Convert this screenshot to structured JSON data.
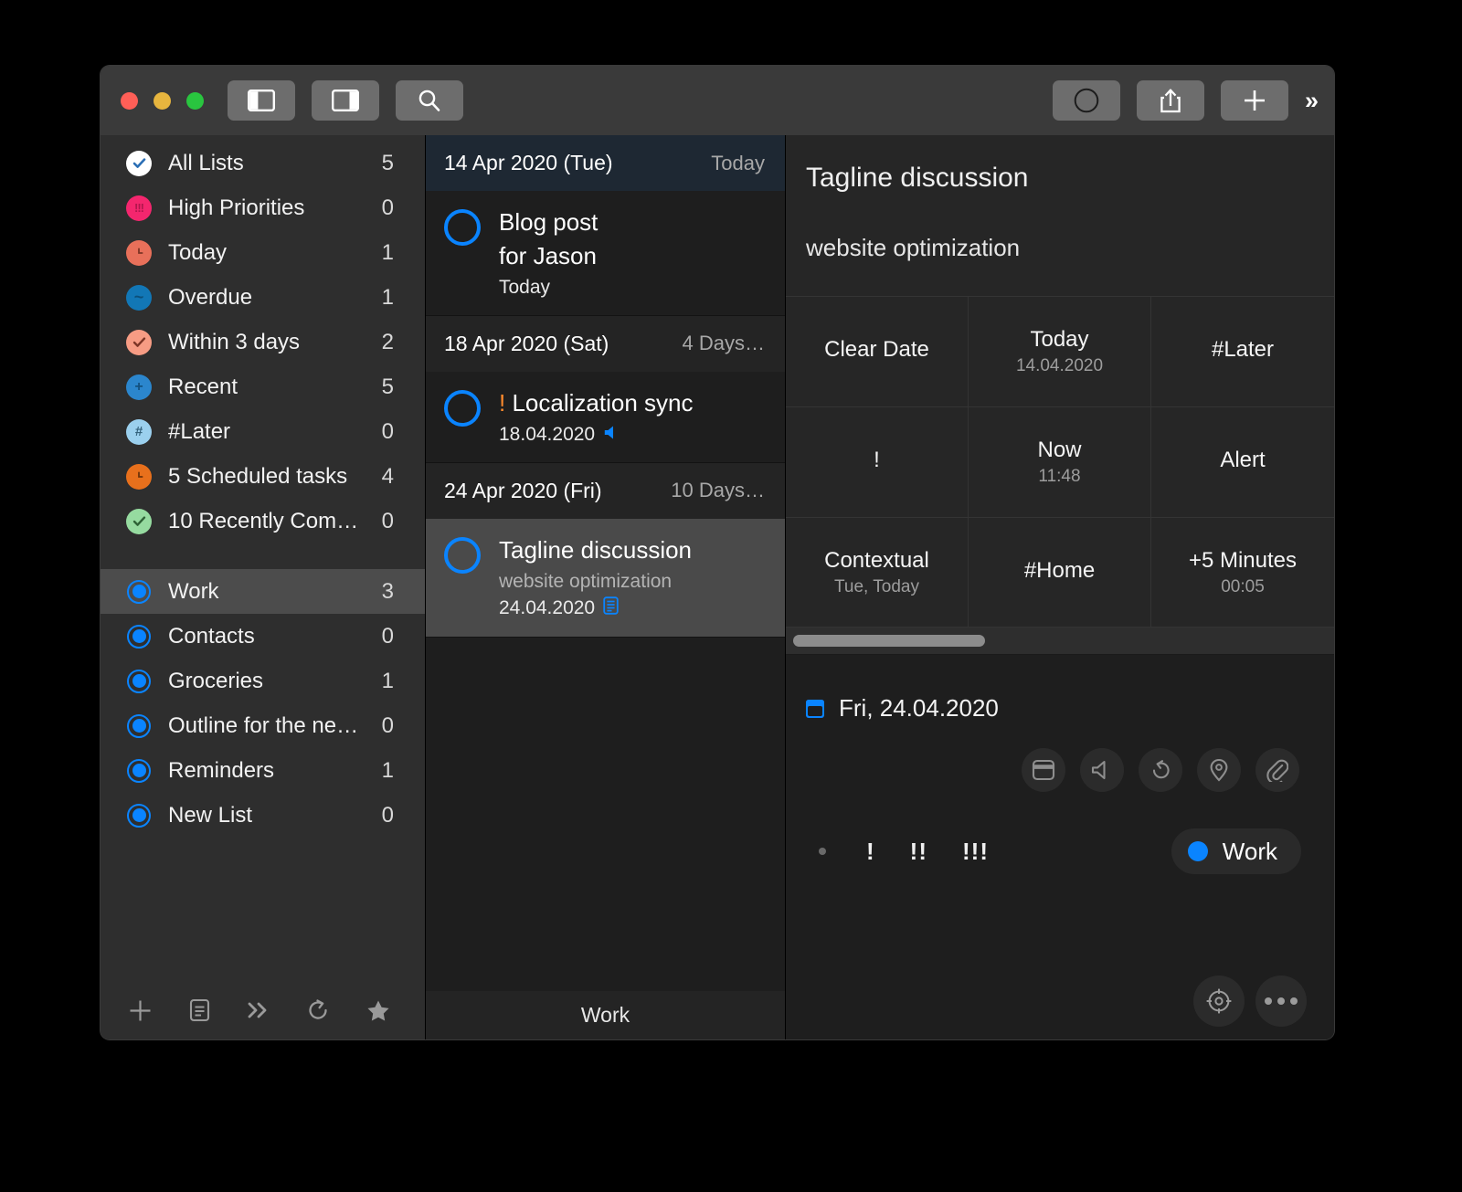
{
  "titlebar": {
    "window_buttons": [
      "close",
      "minimize",
      "maximize"
    ],
    "left_buttons": [
      {
        "name": "toggle-sidebar-button",
        "icon": "sidebar-left-icon"
      },
      {
        "name": "toggle-detail-button",
        "icon": "sidebar-right-icon"
      },
      {
        "name": "search-button",
        "icon": "search-icon"
      }
    ],
    "right_buttons": [
      {
        "name": "complete-button",
        "icon": "circle-icon"
      },
      {
        "name": "share-button",
        "icon": "share-icon"
      },
      {
        "name": "add-task-button",
        "icon": "plus-icon"
      }
    ],
    "overflow_label": "»"
  },
  "sidebar": {
    "smart_lists": [
      {
        "label": "All Lists",
        "count": "5",
        "icon": "check-circle-icon",
        "color": "#ffffff",
        "glyph": "✔"
      },
      {
        "label": "High Priorities",
        "count": "0",
        "icon": "exclamation-circle-icon",
        "color": "#f4266e",
        "glyph": "!!!"
      },
      {
        "label": "Today",
        "count": "1",
        "icon": "clock-circle-icon",
        "color": "#e8705a",
        "glyph": "clock"
      },
      {
        "label": "Overdue",
        "count": "1",
        "icon": "tilde-circle-icon",
        "color": "#1277b6",
        "glyph": "~"
      },
      {
        "label": "Within 3 days",
        "count": "2",
        "icon": "check-circle-icon",
        "color": "#f79c84",
        "glyph": "✔"
      },
      {
        "label": "Recent",
        "count": "5",
        "icon": "plus-circle-icon",
        "color": "#2b86cd",
        "glyph": "+"
      },
      {
        "label": "#Later",
        "count": "0",
        "icon": "hash-circle-icon",
        "color": "#9bd0ee",
        "glyph": "#"
      },
      {
        "label": "5 Scheduled tasks",
        "count": "4",
        "icon": "clock-circle-icon",
        "color": "#e8701c",
        "glyph": "clock"
      },
      {
        "label": "10 Recently Com…",
        "count": "0",
        "icon": "check-circle-icon",
        "color": "#96dba0",
        "glyph": "✔"
      }
    ],
    "user_lists": [
      {
        "label": "Work",
        "count": "3",
        "icon": "list-ring-icon",
        "selected": true
      },
      {
        "label": "Contacts",
        "count": "0",
        "icon": "list-ring-icon",
        "selected": false
      },
      {
        "label": "Groceries",
        "count": "1",
        "icon": "list-ring-icon",
        "selected": false
      },
      {
        "label": "Outline for the ne…",
        "count": "0",
        "icon": "list-ring-icon",
        "selected": false
      },
      {
        "label": "Reminders",
        "count": "1",
        "icon": "list-ring-icon",
        "selected": false
      },
      {
        "label": "New List",
        "count": "0",
        "icon": "list-ring-icon",
        "selected": false
      }
    ],
    "toolbar": [
      {
        "name": "add-list-button",
        "icon": "plus-icon"
      },
      {
        "name": "new-note-button",
        "icon": "note-icon"
      },
      {
        "name": "expand-button",
        "icon": "chevrons-right-icon"
      },
      {
        "name": "refresh-button",
        "icon": "refresh-icon"
      },
      {
        "name": "favorites-button",
        "icon": "star-icon"
      },
      {
        "name": "settings-button",
        "icon": "gear-icon"
      }
    ]
  },
  "task_list": {
    "groups": [
      {
        "date": "14 Apr 2020 (Tue)",
        "relative": "Today",
        "is_today": true,
        "tasks": [
          {
            "title": "Blog post\nfor Jason",
            "note": "",
            "meta": "Today",
            "priority": "",
            "selected": false,
            "has_alert": false,
            "has_note_icon": false
          }
        ]
      },
      {
        "date": "18 Apr 2020 (Sat)",
        "relative": "4 Days…",
        "is_today": false,
        "tasks": [
          {
            "title": "Localization sync",
            "note": "",
            "meta": "18.04.2020",
            "priority": "!",
            "selected": false,
            "has_alert": true,
            "has_note_icon": false
          }
        ]
      },
      {
        "date": "24 Apr 2020 (Fri)",
        "relative": "10 Days…",
        "is_today": false,
        "tasks": [
          {
            "title": "Tagline discussion",
            "note": "website optimization",
            "meta": "24.04.2020",
            "priority": "",
            "selected": true,
            "has_alert": false,
            "has_note_icon": true
          }
        ]
      }
    ],
    "footer_label": "Work"
  },
  "detail": {
    "title": "Tagline discussion",
    "note": "website optimization",
    "quick_actions": [
      {
        "main": "Clear Date",
        "sub": "",
        "name": "clear-date-action"
      },
      {
        "main": "Today",
        "sub": "14.04.2020",
        "name": "today-action"
      },
      {
        "main": "#Later",
        "sub": "",
        "name": "later-tag-action"
      },
      {
        "main": "!",
        "sub": "",
        "name": "priority-action"
      },
      {
        "main": "Now",
        "sub": "11:48",
        "name": "now-action"
      },
      {
        "main": "Alert",
        "sub": "",
        "name": "alert-action"
      },
      {
        "main": "Contextual",
        "sub": "Tue, Today",
        "name": "contextual-action"
      },
      {
        "main": "#Home",
        "sub": "",
        "name": "home-tag-action"
      },
      {
        "main": "+5 Minutes",
        "sub": "00:05",
        "name": "plus-five-minutes-action"
      }
    ],
    "due_date": "Fri, 24.04.2020",
    "attribute_icons": [
      {
        "name": "calendar-icon"
      },
      {
        "name": "alert-speaker-icon"
      },
      {
        "name": "repeat-icon"
      },
      {
        "name": "location-pin-icon"
      },
      {
        "name": "attachment-paperclip-icon"
      }
    ],
    "priorities": [
      "·",
      "!",
      "!!",
      "!!!"
    ],
    "list_chip": {
      "label": "Work",
      "color": "#0a84ff"
    },
    "bottom_buttons": [
      {
        "name": "focus-target-button",
        "icon": "target-icon"
      },
      {
        "name": "more-options-button",
        "icon": "ellipsis-icon"
      }
    ]
  },
  "colors": {
    "accent": "#0a84ff",
    "window_chrome": "#3a3a3a",
    "sidebar_bg": "#2e2e2e",
    "list_bg": "#1e1e1e",
    "detail_bg": "#262626",
    "selection": "#4a4a4a",
    "today_header": "#1e2833",
    "priority_orange": "#ff8b2d"
  }
}
